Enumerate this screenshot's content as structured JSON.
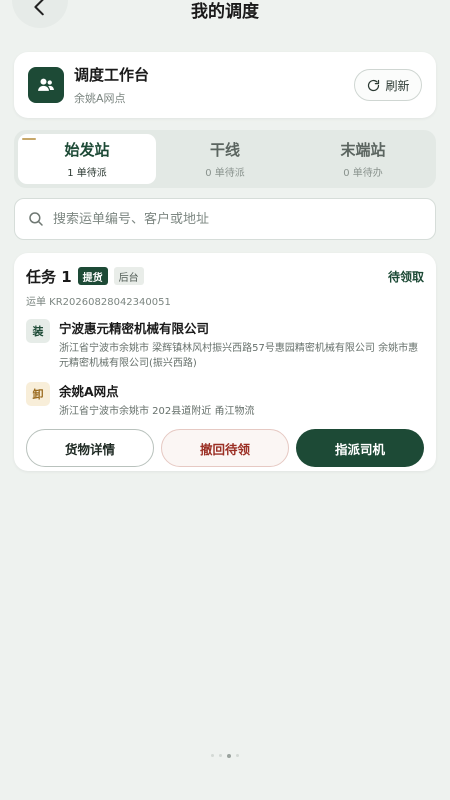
{
  "header": {
    "title": "我的调度",
    "back_icon": "chevron-left-icon"
  },
  "workbench": {
    "title": "调度工作台",
    "station": "余姚A网点",
    "refresh_label": "刷新",
    "icon": "users-icon"
  },
  "tabs": [
    {
      "label": "始发站",
      "count": "1 单待派",
      "active": true
    },
    {
      "label": "干线",
      "count": "0 单待派",
      "active": false
    },
    {
      "label": "末端站",
      "count": "0 单待办",
      "active": false
    }
  ],
  "search": {
    "placeholder": "搜索运单编号、客户或地址",
    "value": ""
  },
  "task": {
    "title": "任务 1",
    "tag_type": "提货",
    "tag_source": "后台",
    "status": "待领取",
    "waybill": "运单 KR20260828042340051",
    "load": {
      "badge": "装",
      "name": "宁波惠元精密机械有限公司",
      "address": "浙江省宁波市余姚市 梁辉镇林风村振兴西路57号惠园精密机械有限公司 余姚市惠元精密机械有限公司(振兴西路)"
    },
    "unload": {
      "badge": "卸",
      "name": "余姚A网点",
      "address": "浙江省宁波市余姚市 202县道附近 甬江物流"
    },
    "actions": {
      "details": "货物详情",
      "withdraw": "撤回待领",
      "assign": "指派司机"
    }
  },
  "colors": {
    "brand": "#1d4a36",
    "danger": "#9b2f24",
    "background": "#eef2ef"
  }
}
